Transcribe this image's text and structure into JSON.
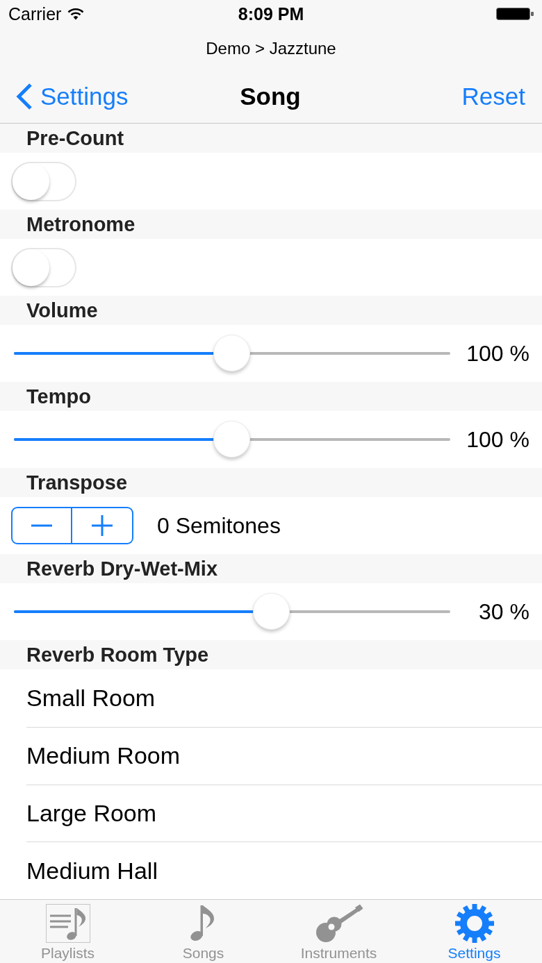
{
  "status_bar": {
    "carrier": "Carrier",
    "time": "8:09 PM"
  },
  "breadcrumb": "Demo > Jazztune",
  "nav_bar": {
    "back": "Settings",
    "title": "Song",
    "action": "Reset"
  },
  "sections": [
    {
      "header": "Pre-Count",
      "kind": "toggle",
      "on": false
    },
    {
      "header": "Metronome",
      "kind": "toggle",
      "on": false
    },
    {
      "header": "Volume",
      "kind": "slider",
      "level": 0.5,
      "reading": "100 %"
    },
    {
      "header": "Tempo",
      "kind": "slider",
      "level": 0.5,
      "reading": "100 %"
    },
    {
      "header": "Transpose",
      "kind": "stepper",
      "reading": "0 Semitones"
    },
    {
      "header": "Reverb Dry-Wet-Mix",
      "kind": "slider",
      "level": 0.59,
      "reading": "30 %"
    },
    {
      "header": "Reverb Room Type",
      "kind": "list",
      "items": [
        "Small Room",
        "Medium Room",
        "Large Room",
        "Medium Hall"
      ]
    }
  ],
  "tab_bar": [
    {
      "label": "Playlists",
      "kind": "playlists",
      "selected": false
    },
    {
      "label": "Songs",
      "kind": "note",
      "selected": false
    },
    {
      "label": "Instruments",
      "kind": "guitar",
      "selected": false
    },
    {
      "label": "Settings",
      "kind": "gear",
      "selected": true
    }
  ]
}
